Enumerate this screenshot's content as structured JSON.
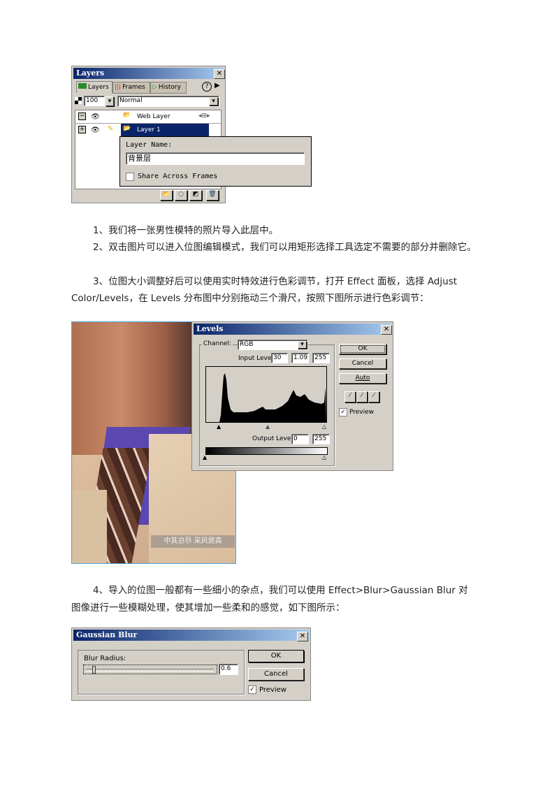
{
  "layers_panel": {
    "title": "Layers",
    "tabs": [
      {
        "label": "Layers",
        "icon": "layers-icon"
      },
      {
        "label": "Frames",
        "icon": "frames-icon"
      },
      {
        "label": "History",
        "icon": "history-icon"
      }
    ],
    "opacity": "100",
    "blend_mode": "Normal",
    "layers": [
      {
        "name": "Web Layer",
        "expanded": true,
        "selected": false
      },
      {
        "name": "Layer 1",
        "expanded": false,
        "selected": true
      }
    ],
    "popup": {
      "label": "Layer Name:",
      "value": "背景层",
      "share_label": "Share Across Frames",
      "share_checked": false
    }
  },
  "paragraphs": {
    "p1": "1、我们将一张男性模特的照片导入此层中。",
    "p2": "2、双击图片可以进入位图编辑模式，我们可以用矩形选择工具选定不需要的部分并删除它。",
    "p3_line1": "3、位图大小调整好后可以使用实时特效进行色彩调节，打开 Effect 面板，选择 Adjust",
    "p3_line2": "Color/Levels，在 Levels 分布图中分别拖动三个滑尺，按照下图所示进行色彩调节：",
    "p4_line1": "4、导入的位图一般都有一些细小的杂点，我们可以使用 Effect>Blur>Gaussian Blur 对",
    "p4_line2": "图像进行一些模糊处理，使其增加一些柔和的感觉，如下图所示："
  },
  "photo": {
    "watermark": "真我风采 尽在其中"
  },
  "levels_dialog": {
    "title": "Levels",
    "channel_label": "Channel:",
    "channel_value": "RGB",
    "input_levels_label": "Input Levels:",
    "input_levels": [
      "30",
      "1.09",
      "255"
    ],
    "output_levels_label": "Output Levels:",
    "output_levels": [
      "0",
      "255"
    ],
    "ok": "OK",
    "cancel": "Cancel",
    "auto": "Auto",
    "preview_label": "Preview",
    "preview_checked": true
  },
  "gaussian_dialog": {
    "title": "Gaussian Blur",
    "radius_label": "Blur Radius:",
    "radius_value": "0.6",
    "ok": "OK",
    "cancel": "Cancel",
    "preview_label": "Preview",
    "preview_checked": true
  }
}
